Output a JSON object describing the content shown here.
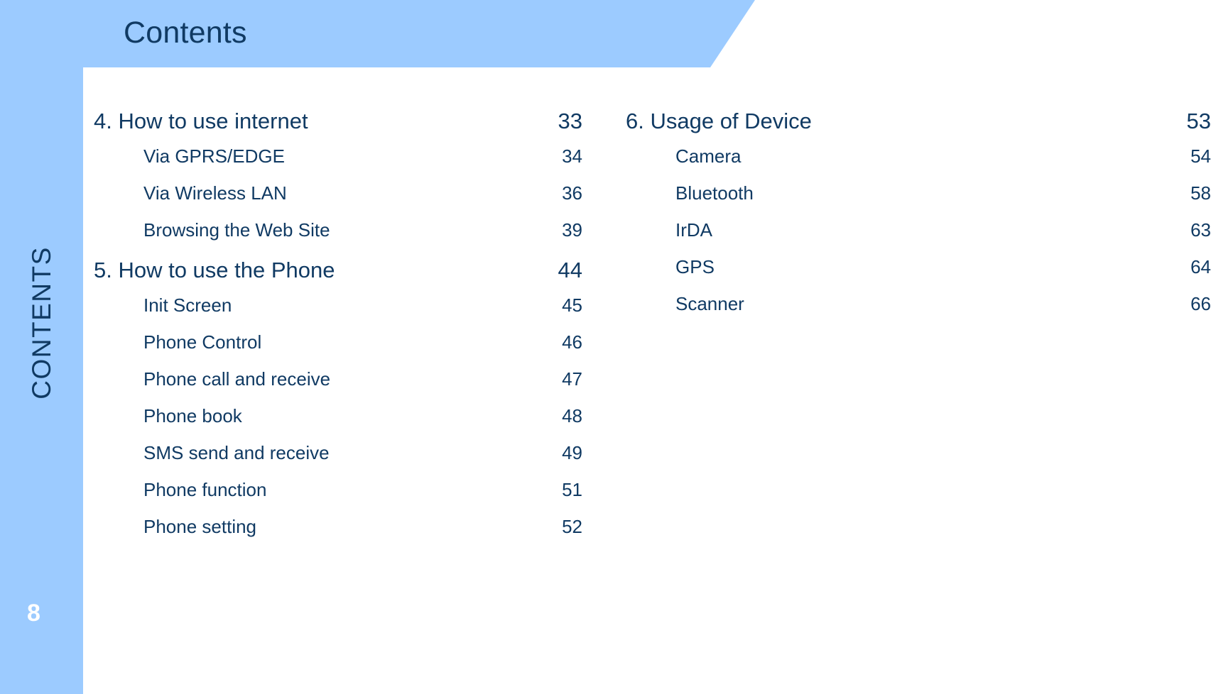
{
  "header": {
    "title": "Contents"
  },
  "sidebar": {
    "vertical_label": "CONTENTS",
    "page_number": "8",
    "bar_color": "#9ccbff",
    "page_number_color": "#ffffff"
  },
  "theme": {
    "accent_blue": "#9ccbff",
    "text_navy": "#103a63",
    "panel_white": "#ffffff"
  },
  "toc": {
    "left_column": [
      {
        "type": "chapter",
        "label": "4. How to use internet",
        "page": "33"
      },
      {
        "type": "entry",
        "label": "Via GPRS/EDGE",
        "page": "34"
      },
      {
        "type": "entry",
        "label": "Via Wireless LAN",
        "page": "36"
      },
      {
        "type": "entry",
        "label": "Browsing  the  Web  Site",
        "page": "39"
      },
      {
        "type": "chapter",
        "label": "5. How to use the Phone",
        "page": "44"
      },
      {
        "type": "entry",
        "label": "Init Screen",
        "page": "45"
      },
      {
        "type": "entry",
        "label": "Phone Control",
        "page": "46"
      },
      {
        "type": "entry",
        "label": "Phone call and receive",
        "page": "47"
      },
      {
        "type": "entry",
        "label": "Phone book",
        "page": "48"
      },
      {
        "type": "entry",
        "label": "SMS  send  and  receive",
        "page": "49"
      },
      {
        "type": "entry",
        "label": "Phone  function",
        "page": "51"
      },
      {
        "type": "entry",
        "label": "Phone setting",
        "page": "52"
      }
    ],
    "right_column": [
      {
        "type": "chapter",
        "label": "6. Usage of Device",
        "page": "53"
      },
      {
        "type": "entry",
        "label": "Camera",
        "page": "54"
      },
      {
        "type": "entry",
        "label": "Bluetooth",
        "page": "58"
      },
      {
        "type": "entry",
        "label": "IrDA",
        "page": "63"
      },
      {
        "type": "entry",
        "label": "GPS",
        "page": "64"
      },
      {
        "type": "entry",
        "label": "Scanner",
        "page": "66"
      }
    ]
  }
}
